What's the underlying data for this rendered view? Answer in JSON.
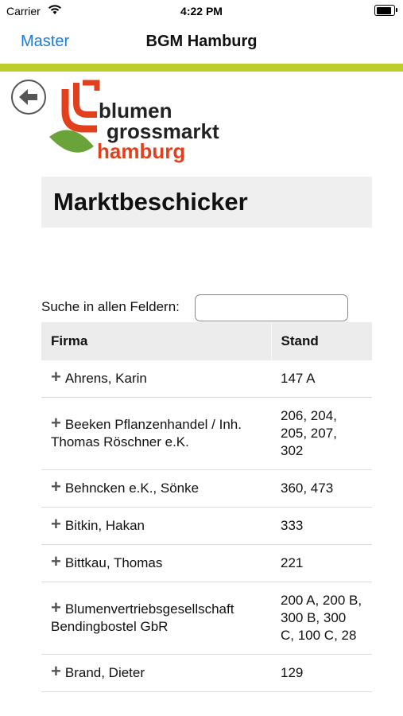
{
  "status_bar": {
    "carrier": "Carrier",
    "time": "4:22 PM"
  },
  "nav": {
    "back_label": "Master",
    "title": "BGM Hamburg"
  },
  "logo": {
    "line1": "blumen",
    "line2": "grossmarkt",
    "line3": "hamburg"
  },
  "page": {
    "heading": "Marktbeschicker"
  },
  "search": {
    "label": "Suche in allen Feldern:",
    "value": ""
  },
  "table": {
    "headers": [
      "Firma",
      "Stand"
    ],
    "rows": [
      {
        "firma": "Ahrens, Karin",
        "stand": "147 A"
      },
      {
        "firma": "Beeken Pflanzenhandel / Inh. Thomas Röschner e.K.",
        "stand": "206, 204, 205, 207, 302"
      },
      {
        "firma": "Behncken e.K., Sönke",
        "stand": "360, 473"
      },
      {
        "firma": "Bitkin, Hakan",
        "stand": "333"
      },
      {
        "firma": "Bittkau, Thomas",
        "stand": "221"
      },
      {
        "firma": "Blumenvertriebsgesellschaft Bendingbostel GbR",
        "stand": "200 A, 200 B, 300 B, 300 C, 100 C, 28"
      },
      {
        "firma": "Brand, Dieter",
        "stand": "129"
      }
    ]
  },
  "colors": {
    "accent": "#1f7ae0",
    "green_bar": "#bccd2e",
    "logo_red": "#e2401c",
    "logo_green": "#6aa33a"
  },
  "icons": {
    "expand": "plus-icon",
    "back": "back-arrow-icon"
  }
}
